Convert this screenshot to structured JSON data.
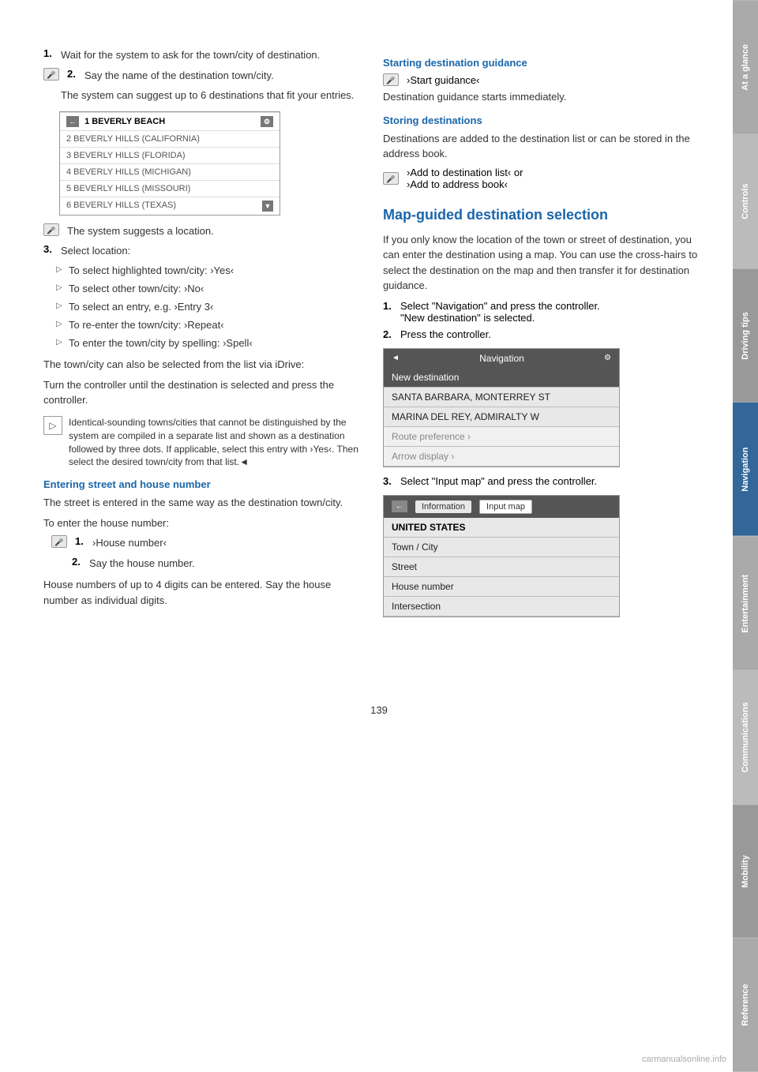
{
  "page": {
    "number": "139",
    "watermark": "carmanualsonline.info"
  },
  "side_tabs": [
    {
      "label": "At a glance",
      "active": false
    },
    {
      "label": "Controls",
      "active": false
    },
    {
      "label": "Driving tips",
      "active": false
    },
    {
      "label": "Navigation",
      "active": true
    },
    {
      "label": "Entertainment",
      "active": false
    },
    {
      "label": "Communications",
      "active": false
    },
    {
      "label": "Mobility",
      "active": false
    },
    {
      "label": "Reference",
      "active": false
    }
  ],
  "left_column": {
    "item1": "Wait for the system to ask for the town/city of destination.",
    "item2_prefix": "Say the name of the destination town/city.",
    "suggest_text": "The system can suggest up to 6 destinations that fit your entries.",
    "dest_list": {
      "item1": "1 BEVERLY BEACH",
      "item2": "2 BEVERLY HILLS (CALIFORNIA)",
      "item3": "3 BEVERLY HILLS (FLORIDA)",
      "item4": "4 BEVERLY HILLS (MICHIGAN)",
      "item5": "5 BEVERLY HILLS (MISSOURI)",
      "item6": "6 BEVERLY HILLS (TEXAS)"
    },
    "suggest_location": "The system suggests a location.",
    "item3": "Select location:",
    "sub_items": [
      {
        "text": "To select highlighted town/city: ›Yes‹"
      },
      {
        "text": "To select other town/city: ›No‹"
      },
      {
        "text": "To select an entry, e.g. ›Entry 3‹"
      },
      {
        "text": "To re-enter the town/city: ›Repeat‹"
      },
      {
        "text": "To enter the town/city by spelling: ›Spell‹"
      }
    ],
    "town_note1": "The town/city can also be selected from the list via iDrive:",
    "town_note2": "Turn the controller until the destination is selected and press the controller.",
    "note_box": "Identical-sounding towns/cities that cannot be distinguished by the system are compiled in a separate list and shown as a destination followed by three dots. If applicable, select this entry with ›Yes‹. Then select the desired town/city from that list.◄",
    "entering_heading": "Entering street and house number",
    "entering_body": "The street is entered in the same way as the destination town/city.",
    "house_intro": "To enter the house number:",
    "house_item1": "›House number‹",
    "house_item2": "Say the house number.",
    "house_note": "House numbers of up to 4 digits can be entered. Say the house number as individual digits."
  },
  "right_column": {
    "starting_heading": "Starting destination guidance",
    "start_cmd": "›Start guidance‹",
    "start_body": "Destination guidance starts immediately.",
    "storing_heading": "Storing destinations",
    "storing_body": "Destinations are added to the destination list or can be stored in the address book.",
    "add_cmd1": "›Add to destination list‹ or",
    "add_cmd2": "›Add to address book‹",
    "map_heading": "Map-guided destination selection",
    "map_body": "If you only know the location of the town or street of destination, you can enter the destination using a map. You can use the cross-hairs to select the destination on the map and then transfer it for destination guidance.",
    "step1": "Select \"Navigation\" and press the controller.",
    "step1b": "\"New destination\" is selected.",
    "step2": "Press the controller.",
    "nav_ui": {
      "header": "Navigation",
      "row1": "New destination",
      "row2": "SANTA BARBARA, MONTERREY ST",
      "row3": "MARINA DEL REY, ADMIRALTY W",
      "row4": "Route preference ›",
      "row5": "Arrow display ›"
    },
    "step3": "Select \"Input map\" and press the controller.",
    "input_map_ui": {
      "tab1": "Information",
      "tab2": "Input map",
      "row1": "UNITED STATES",
      "row2": "Town / City",
      "row3": "Street",
      "row4": "House number",
      "row5": "Intersection"
    }
  }
}
